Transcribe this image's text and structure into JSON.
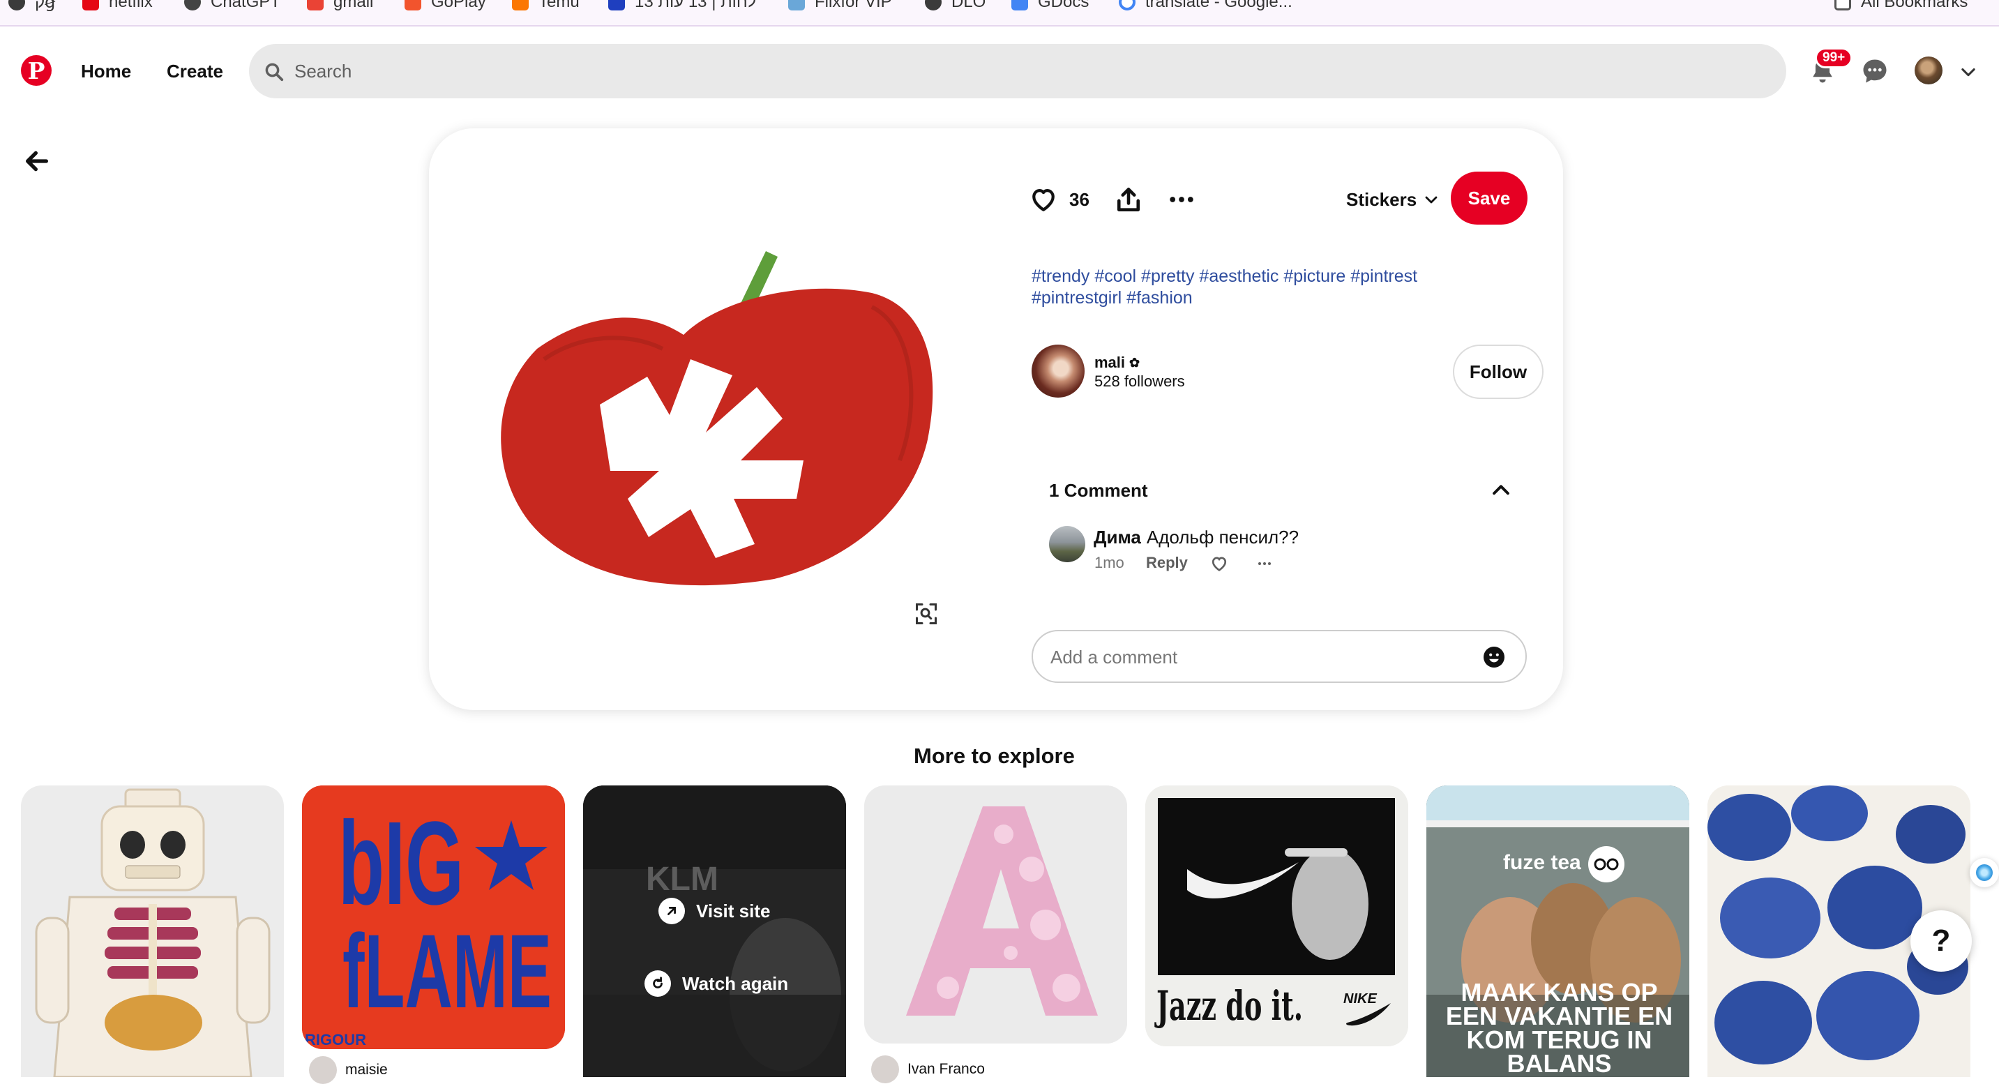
{
  "bookmarks": [
    {
      "label": "קꞡ",
      "color": "#3b3b3b",
      "icon": "globe-icon"
    },
    {
      "label": "netflix",
      "color": "#e50914",
      "icon": "netflix-icon"
    },
    {
      "label": "ChatGPT",
      "color": "#444444",
      "icon": "chatgpt-icon"
    },
    {
      "label": "gmail",
      "color": "#ea4335",
      "icon": "gmail-icon"
    },
    {
      "label": "GoPlay",
      "color": "#f2542d",
      "icon": "goplay-icon"
    },
    {
      "label": "Temu",
      "color": "#fb7701",
      "icon": "temu-icon"
    },
    {
      "label": "13 לחות | 13 עות",
      "color": "#1f3fbf",
      "icon": "news-icon"
    },
    {
      "label": "Flixfor VIP",
      "color": "#6aa7d8",
      "icon": "flixfor-icon"
    },
    {
      "label": "DLO",
      "color": "#3b3b3b",
      "icon": "globe-icon"
    },
    {
      "label": "GDocs",
      "color": "#4285f4",
      "icon": "gdocs-icon"
    },
    {
      "label": "translate - Google...",
      "color": "#4285f4",
      "icon": "google-icon"
    }
  ],
  "all_bookmarks": "All Bookmarks",
  "header": {
    "home": "Home",
    "create": "Create",
    "search_placeholder": "Search",
    "notifications_badge": "99+"
  },
  "pin": {
    "likes": "36",
    "board": "Stickers",
    "save": "Save",
    "tags": "#trendy #cool #pretty #aesthetic #picture #pintrest #pintrestgirl #fashion",
    "creator": {
      "name": "mali",
      "followers": "528 followers"
    },
    "follow": "Follow",
    "comments_title": "1 Comment",
    "comment": {
      "author": "Дима",
      "text": "Адольф пенсил??",
      "time": "1mo",
      "reply": "Reply"
    },
    "add_comment_placeholder": "Add a comment"
  },
  "explore": {
    "title": "More to explore",
    "tiles": [
      {
        "name": "",
        "image": "lego skeleton figure"
      },
      {
        "name": "maisie",
        "image": "big flame poster"
      },
      {
        "name": "",
        "image": "KLM video",
        "visit_site": "Visit site",
        "watch_again": "Watch again"
      },
      {
        "name": "Ivan Franco",
        "image": "pink bubble letter A"
      },
      {
        "name": "",
        "image": "Jazz do it poster",
        "caption_text": "Jazz do it."
      },
      {
        "name": "",
        "image": "fuze tea tripadvisor ad",
        "ad_text": "MAAK KANS OP EEN VAKANTIE EN KOM TERUG IN BALANS"
      },
      {
        "name": "",
        "image": "blue NY caps painting"
      }
    ],
    "poster_text": {
      "big": "bIG",
      "flame": "fLAME",
      "corner": "RIGOUR",
      "klm": "KLM",
      "nike": "NIKE",
      "fuze": "fuze tea"
    }
  },
  "help": "?",
  "colors": {
    "brand": "#e60023",
    "tag": "#2f4d9e"
  }
}
